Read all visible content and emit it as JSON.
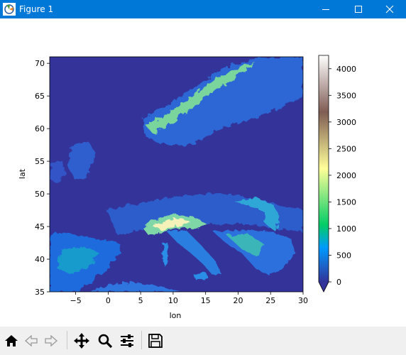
{
  "window": {
    "title": "Figure 1"
  },
  "plot": {
    "xlabel": "lon",
    "ylabel": "lat",
    "xticks": [
      "−5",
      "0",
      "5",
      "10",
      "15",
      "20",
      "25",
      "30"
    ],
    "yticks": [
      "35",
      "40",
      "45",
      "50",
      "55",
      "60",
      "65",
      "70"
    ],
    "xlim": [
      -9,
      30
    ],
    "ylim": [
      35,
      71
    ]
  },
  "colorbar": {
    "ticks": [
      "0",
      "500",
      "1000",
      "1500",
      "2000",
      "2500",
      "3000",
      "3500",
      "4000"
    ],
    "range": [
      0,
      4250
    ],
    "colormap": "terrain",
    "extend": "min"
  },
  "colors": {
    "titlebar": "#0078d7",
    "ocean": "#333399",
    "toolbar_bg": "#f0f0f0"
  },
  "toolbar": {
    "icons": [
      "home-icon",
      "back-arrow-icon",
      "forward-arrow-icon",
      "pan-icon",
      "zoom-icon",
      "configure-subplots-icon",
      "save-icon"
    ]
  }
}
